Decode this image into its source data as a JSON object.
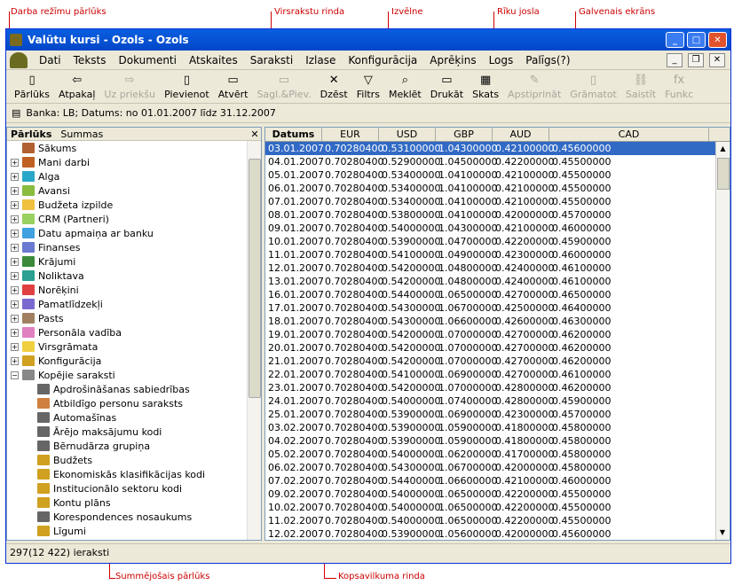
{
  "annotations": {
    "nav": "Darba režīmu pārlūks",
    "header": "Virsrakstu rinda",
    "menu": "Izvēlne",
    "toolbar": "Rīku josla",
    "main": "Galvenais ekrāns",
    "summary_nav": "Summējošais pārlūks",
    "summary_row": "Kopsavilkuma rinda"
  },
  "window": {
    "title": "Valūtu kursi - Ozols - Ozols"
  },
  "menu": [
    "Dati",
    "Teksts",
    "Dokumenti",
    "Atskaites",
    "Saraksti",
    "Izlase",
    "Konfigurācija",
    "Aprēķins",
    "Logs",
    "Palīgs(?)"
  ],
  "toolbar": [
    {
      "label": "Pārlūks",
      "icon": "▯",
      "disabled": false
    },
    {
      "label": "Atpakaļ",
      "icon": "⇦",
      "disabled": false
    },
    {
      "label": "Uz priekšu",
      "icon": "⇨",
      "disabled": true
    },
    {
      "label": "Pievienot",
      "icon": "▯",
      "disabled": false
    },
    {
      "label": "Atvērt",
      "icon": "▭",
      "disabled": false
    },
    {
      "label": "Sagl.&Piev.",
      "icon": "▭",
      "disabled": true
    },
    {
      "label": "Dzēst",
      "icon": "✕",
      "disabled": false
    },
    {
      "label": "Filtrs",
      "icon": "▽",
      "disabled": false
    },
    {
      "label": "Meklēt",
      "icon": "⌕",
      "disabled": false
    },
    {
      "label": "Drukāt",
      "icon": "▭",
      "disabled": false
    },
    {
      "label": "Skats",
      "icon": "▦",
      "disabled": false
    },
    {
      "label": "Apstiprināt",
      "icon": "✎",
      "disabled": true
    },
    {
      "label": "Grāmatot",
      "icon": "▯",
      "disabled": true
    },
    {
      "label": "Saistīt",
      "icon": "⛓",
      "disabled": true
    },
    {
      "label": "Funkc",
      "icon": "fx",
      "disabled": true
    }
  ],
  "info": "Banka: LB; Datums: no 01.01.2007 līdz 31.12.2007",
  "left": {
    "tab1": "Pārlūks",
    "tab2": "Summas",
    "close": "✕"
  },
  "tree": [
    {
      "label": "Sākums",
      "level": 0,
      "exp": "",
      "icon": "home-icon",
      "color": "#b06030"
    },
    {
      "label": "Mani darbi",
      "level": 0,
      "exp": "+",
      "icon": "folder-icon",
      "color": "#c06020"
    },
    {
      "label": "Alga",
      "level": 0,
      "exp": "+",
      "icon": "folder-icon",
      "color": "#2aa7c8"
    },
    {
      "label": "Avansi",
      "level": 0,
      "exp": "+",
      "icon": "folder-icon",
      "color": "#8abc40"
    },
    {
      "label": "Budžeta izpilde",
      "level": 0,
      "exp": "+",
      "icon": "folder-icon",
      "color": "#f0c040"
    },
    {
      "label": "CRM (Partneri)",
      "level": 0,
      "exp": "+",
      "icon": "folder-icon",
      "color": "#9ad060"
    },
    {
      "label": "Datu apmaiņa ar banku",
      "level": 0,
      "exp": "+",
      "icon": "folder-icon",
      "color": "#40a0e0"
    },
    {
      "label": "Finanses",
      "level": 0,
      "exp": "+",
      "icon": "folder-icon",
      "color": "#6a7ad0"
    },
    {
      "label": "Krājumi",
      "level": 0,
      "exp": "+",
      "icon": "folder-icon",
      "color": "#3a8a3a"
    },
    {
      "label": "Noliktava",
      "level": 0,
      "exp": "+",
      "icon": "folder-icon",
      "color": "#2aa090"
    },
    {
      "label": "Norēķini",
      "level": 0,
      "exp": "+",
      "icon": "folder-icon",
      "color": "#e04040"
    },
    {
      "label": "Pamatlīdzekļi",
      "level": 0,
      "exp": "+",
      "icon": "folder-icon",
      "color": "#7a6ad0"
    },
    {
      "label": "Pasts",
      "level": 0,
      "exp": "+",
      "icon": "envelope-icon",
      "color": "#a08060"
    },
    {
      "label": "Personāla vadība",
      "level": 0,
      "exp": "+",
      "icon": "folder-icon",
      "color": "#e080c0"
    },
    {
      "label": "Virsgrāmata",
      "level": 0,
      "exp": "+",
      "icon": "folder-icon",
      "color": "#f0d040"
    },
    {
      "label": "Konfigurācija",
      "level": 0,
      "exp": "+",
      "icon": "gear-icon",
      "color": "#d0a020"
    },
    {
      "label": "Kopējie saraksti",
      "level": 0,
      "exp": "−",
      "icon": "list-icon",
      "color": "#888888"
    },
    {
      "label": "Apdrošināšanas sabiedrības",
      "level": 1,
      "exp": "",
      "icon": "list-icon",
      "color": "#666666"
    },
    {
      "label": "Atbildīgo personu saraksts",
      "level": 1,
      "exp": "",
      "icon": "person-icon",
      "color": "#d08040"
    },
    {
      "label": "Automašīnas",
      "level": 1,
      "exp": "",
      "icon": "list-icon",
      "color": "#666666"
    },
    {
      "label": "Ārējo maksājumu kodi",
      "level": 1,
      "exp": "",
      "icon": "list-icon",
      "color": "#666666"
    },
    {
      "label": "Bērnudārza grupiņa",
      "level": 1,
      "exp": "",
      "icon": "list-icon",
      "color": "#666666"
    },
    {
      "label": "Budžets",
      "level": 1,
      "exp": "",
      "icon": "tree-icon",
      "color": "#d0a020"
    },
    {
      "label": "Ekonomiskās klasifikācijas kodi",
      "level": 1,
      "exp": "",
      "icon": "tree-icon",
      "color": "#d0a020"
    },
    {
      "label": "Institucionālo sektoru kodi",
      "level": 1,
      "exp": "",
      "icon": "tree-icon",
      "color": "#d0a020"
    },
    {
      "label": "Kontu plāns",
      "level": 1,
      "exp": "",
      "icon": "tree-icon",
      "color": "#d0a020"
    },
    {
      "label": "Korespondences nosaukums",
      "level": 1,
      "exp": "",
      "icon": "list-icon",
      "color": "#666666"
    },
    {
      "label": "Līgumi",
      "level": 1,
      "exp": "",
      "icon": "tree-icon",
      "color": "#d0a020"
    }
  ],
  "grid": {
    "columns": [
      "Datums",
      "EUR",
      "USD",
      "GBP",
      "AUD",
      "CAD"
    ],
    "rows": [
      [
        "03.01.2007",
        "0.70280400",
        "0.53100000",
        "1.04300000",
        "0.42100000",
        "0.45600000"
      ],
      [
        "04.01.2007",
        "0.70280400",
        "0.52900000",
        "1.04500000",
        "0.42200000",
        "0.45500000"
      ],
      [
        "05.01.2007",
        "0.70280400",
        "0.53400000",
        "1.04100000",
        "0.42100000",
        "0.45500000"
      ],
      [
        "06.01.2007",
        "0.70280400",
        "0.53400000",
        "1.04100000",
        "0.42100000",
        "0.45500000"
      ],
      [
        "07.01.2007",
        "0.70280400",
        "0.53400000",
        "1.04100000",
        "0.42100000",
        "0.45500000"
      ],
      [
        "08.01.2007",
        "0.70280400",
        "0.53800000",
        "1.04100000",
        "0.42000000",
        "0.45700000"
      ],
      [
        "09.01.2007",
        "0.70280400",
        "0.54000000",
        "1.04300000",
        "0.42100000",
        "0.46000000"
      ],
      [
        "10.01.2007",
        "0.70280400",
        "0.53900000",
        "1.04700000",
        "0.42200000",
        "0.45900000"
      ],
      [
        "11.01.2007",
        "0.70280400",
        "0.54100000",
        "1.04900000",
        "0.42300000",
        "0.46000000"
      ],
      [
        "12.01.2007",
        "0.70280400",
        "0.54200000",
        "1.04800000",
        "0.42400000",
        "0.46100000"
      ],
      [
        "13.01.2007",
        "0.70280400",
        "0.54200000",
        "1.04800000",
        "0.42400000",
        "0.46100000"
      ],
      [
        "16.01.2007",
        "0.70280400",
        "0.54400000",
        "1.06500000",
        "0.42700000",
        "0.46500000"
      ],
      [
        "17.01.2007",
        "0.70280400",
        "0.54300000",
        "1.06700000",
        "0.42500000",
        "0.46400000"
      ],
      [
        "18.01.2007",
        "0.70280400",
        "0.54300000",
        "1.06600000",
        "0.42600000",
        "0.46300000"
      ],
      [
        "19.01.2007",
        "0.70280400",
        "0.54200000",
        "1.07000000",
        "0.42700000",
        "0.46200000"
      ],
      [
        "20.01.2007",
        "0.70280400",
        "0.54200000",
        "1.07000000",
        "0.42700000",
        "0.46200000"
      ],
      [
        "21.01.2007",
        "0.70280400",
        "0.54200000",
        "1.07000000",
        "0.42700000",
        "0.46200000"
      ],
      [
        "22.01.2007",
        "0.70280400",
        "0.54100000",
        "1.06900000",
        "0.42700000",
        "0.46100000"
      ],
      [
        "23.01.2007",
        "0.70280400",
        "0.54200000",
        "1.07000000",
        "0.42800000",
        "0.46200000"
      ],
      [
        "24.01.2007",
        "0.70280400",
        "0.54000000",
        "1.07400000",
        "0.42800000",
        "0.45900000"
      ],
      [
        "25.01.2007",
        "0.70280400",
        "0.53900000",
        "1.06900000",
        "0.42300000",
        "0.45700000"
      ],
      [
        "03.02.2007",
        "0.70280400",
        "0.53900000",
        "1.05900000",
        "0.41800000",
        "0.45800000"
      ],
      [
        "04.02.2007",
        "0.70280400",
        "0.53900000",
        "1.05900000",
        "0.41800000",
        "0.45800000"
      ],
      [
        "05.02.2007",
        "0.70280400",
        "0.54000000",
        "1.06200000",
        "0.41700000",
        "0.45800000"
      ],
      [
        "06.02.2007",
        "0.70280400",
        "0.54300000",
        "1.06700000",
        "0.42000000",
        "0.45800000"
      ],
      [
        "07.02.2007",
        "0.70280400",
        "0.54400000",
        "1.06600000",
        "0.42100000",
        "0.46000000"
      ],
      [
        "09.02.2007",
        "0.70280400",
        "0.54000000",
        "1.06500000",
        "0.42200000",
        "0.45500000"
      ],
      [
        "10.02.2007",
        "0.70280400",
        "0.54000000",
        "1.06500000",
        "0.42200000",
        "0.45500000"
      ],
      [
        "11.02.2007",
        "0.70280400",
        "0.54000000",
        "1.06500000",
        "0.42200000",
        "0.45500000"
      ],
      [
        "12.02.2007",
        "0.70280400",
        "0.53900000",
        "1.05600000",
        "0.42000000",
        "0.45600000"
      ]
    ]
  },
  "status": "297(12 422) ieraksti"
}
